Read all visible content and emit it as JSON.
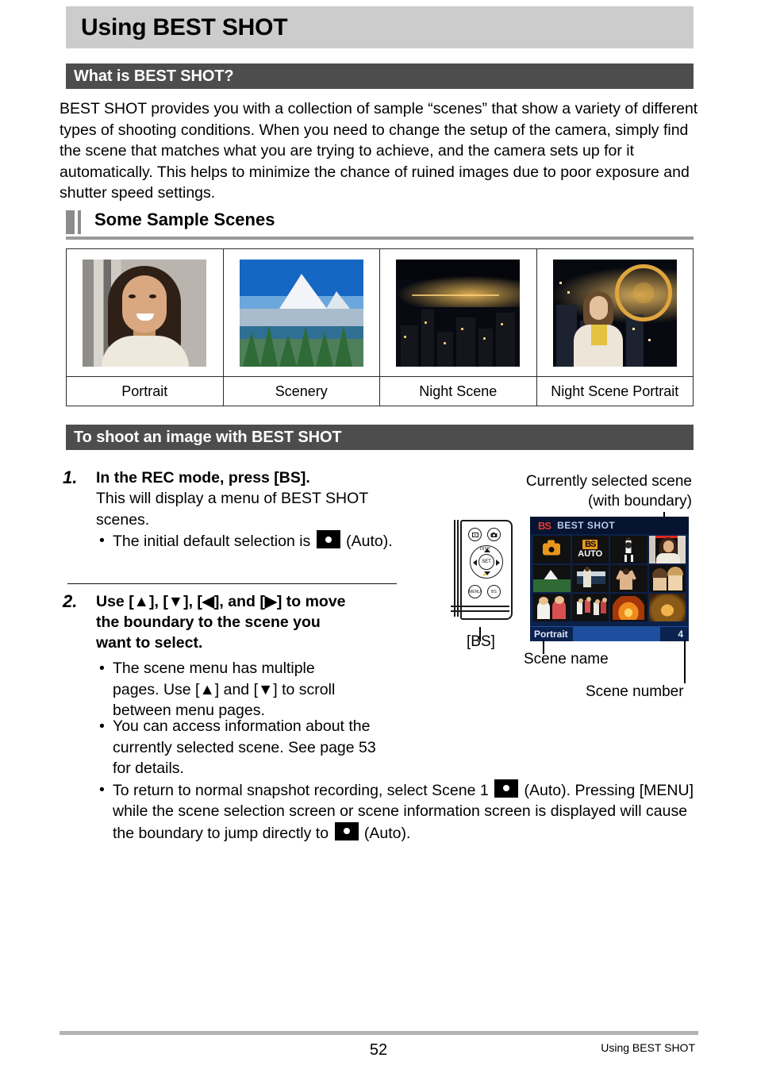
{
  "page_title": "Using BEST SHOT",
  "sections": {
    "what_is": {
      "heading": "What is BEST SHOT?",
      "paragraph": "BEST SHOT provides you with a collection of sample “scenes” that show a variety of different types of shooting conditions. When you need to change the setup of the camera, simply find the scene that matches what you are trying to achieve, and the camera sets up for it automatically. This helps to minimize the chance of ruined images due to poor exposure and shutter speed settings."
    },
    "sample_scenes": {
      "heading": "Some Sample Scenes",
      "items": [
        {
          "label": "Portrait"
        },
        {
          "label": "Scenery"
        },
        {
          "label": "Night Scene"
        },
        {
          "label": "Night Scene Portrait"
        }
      ]
    },
    "to_shoot": {
      "heading": "To shoot an image with BEST SHOT",
      "steps": [
        {
          "number": "1.",
          "title": "In the REC mode, press [BS].",
          "body": "This will display a menu of BEST SHOT scenes.",
          "bullets": [
            {
              "pre": "The initial default selection is ",
              "icon": "auto-mode-icon",
              "post": " (Auto)."
            }
          ]
        },
        {
          "number": "2.",
          "title_parts": [
            "Use [",
            "▲",
            "], [",
            "▼",
            "], [",
            "◀",
            "], and [",
            "▶",
            "] to move the boundary to the scene you want to select."
          ],
          "title_plain": "Use [▲], [▼], [◀], and [▶] to move the boundary to the scene you want to select.",
          "bullets": [
            {
              "text": "The scene menu has multiple pages. Use [▲] and [▼] to scroll between menu pages."
            },
            {
              "text": "You can access information about the currently selected scene. See page 53 for details."
            },
            {
              "pre": "To return to normal snapshot recording, select Scene 1 ",
              "icon": "auto-mode-icon",
              "post": " (Auto). Pressing [MENU] while the scene selection screen or scene information screen is displayed will cause the boundary to jump directly to ",
              "icon2": "auto-mode-icon",
              "post2": " (Auto)."
            }
          ]
        }
      ]
    }
  },
  "illustration": {
    "callout_selected_line1": "Currently selected scene",
    "callout_selected_line2": "(with boundary)",
    "bs_button_label": "[BS]",
    "callout_scene_name": "Scene name",
    "callout_scene_number": "Scene number",
    "camera_buttons": [
      {
        "name": "playback-button",
        "glyph": "▶"
      },
      {
        "name": "record-button",
        "glyph": "●"
      },
      {
        "name": "menu-button",
        "label": "MENU"
      },
      {
        "name": "bs-button",
        "label": "BS"
      }
    ],
    "dpad": {
      "top_label": "DISP",
      "center_label": "SET",
      "bottom_label": "⚡"
    },
    "lcd": {
      "logo": "BS",
      "title": "BEST SHOT",
      "scene_name": "Portrait",
      "scene_number": "4",
      "selected_index": 3,
      "cells": [
        {
          "name": "auto",
          "art": "c-auto"
        },
        {
          "name": "bs-auto",
          "art": "c-bsauto"
        },
        {
          "name": "sports",
          "art": "c-sports"
        },
        {
          "name": "portrait",
          "art": "c-prt"
        },
        {
          "name": "scenery",
          "art": "c-scn"
        },
        {
          "name": "portrait-scenery",
          "art": "c-boat"
        },
        {
          "name": "beach",
          "art": "c-beach"
        },
        {
          "name": "couple",
          "art": "c-kids2"
        },
        {
          "name": "children",
          "art": "c-child"
        },
        {
          "name": "sports-kids",
          "art": "c-soccer"
        },
        {
          "name": "candlelight",
          "art": "c-fire"
        },
        {
          "name": "party",
          "art": "c-party"
        }
      ]
    }
  },
  "colors": {
    "title_bar": "#cccccc",
    "section_bar": "#4d4d4d",
    "selection_boundary": "#e8261c",
    "lcd_background": "#0c2149",
    "footer_rule": "#b3b3b3"
  },
  "footer": {
    "page_number": "52",
    "running_head": "Using BEST SHOT"
  }
}
